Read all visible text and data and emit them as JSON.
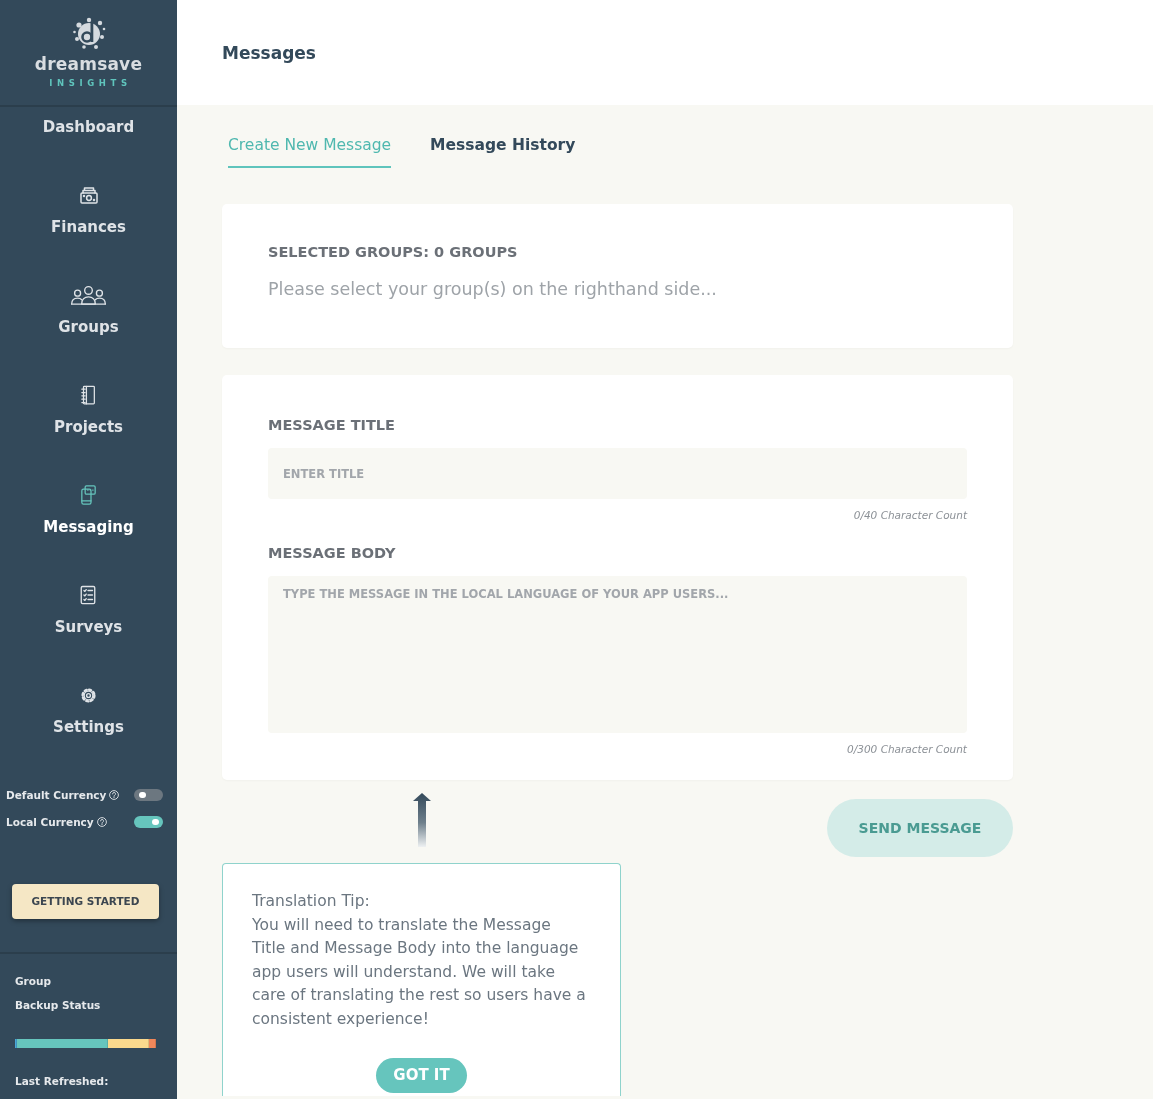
{
  "sidebar": {
    "logo": {
      "name": "dreamsave",
      "tagline": "INSIGHTS"
    },
    "items": [
      {
        "label": "Dashboard",
        "kind": "text",
        "selected": false
      },
      {
        "label": "Finances",
        "kind": "icon",
        "selected": false
      },
      {
        "label": "Groups",
        "kind": "icon",
        "selected": false
      },
      {
        "label": "Projects",
        "kind": "icon",
        "selected": false
      },
      {
        "label": "Messaging",
        "kind": "icon",
        "selected": true
      },
      {
        "label": "Surveys",
        "kind": "icon",
        "selected": false
      },
      {
        "label": "Settings",
        "kind": "icon",
        "selected": false
      }
    ],
    "currency_toggles": [
      {
        "label": "Default Currency",
        "on": false
      },
      {
        "label": "Local Currency",
        "on": true
      }
    ],
    "getting_started": {
      "label": "GETTING STARTED"
    },
    "backup": {
      "title": "Group",
      "subtitle": "Backup Status",
      "last_refreshed": "Last Refreshed:"
    }
  },
  "header": {
    "title": "Messages"
  },
  "tabs": [
    {
      "label": "Create New Message",
      "selected": true
    },
    {
      "label": "Message History",
      "selected": false
    }
  ],
  "selected_groups": {
    "heading": "SELECTED GROUPS: **0 GROUPS**",
    "hint": "Please select your group(s) on the righthand side..."
  },
  "form": {
    "fields": [
      {
        "kind": "input",
        "label": "MESSAGE TITLE",
        "placeholder": "ENTER TITLE",
        "counter": "0/40 Character Count"
      },
      {
        "kind": "textarea",
        "label": "MESSAGE BODY",
        "placeholder": "TYPE THE MESSAGE IN THE LOCAL LANGUAGE OF YOUR APP USERS...",
        "counter": "0/300 Character Count"
      }
    ]
  },
  "send_button": {
    "label": "SEND MESSAGE",
    "disabled": true
  },
  "tip": {
    "title": "Translation Tip:",
    "body": "You will need to translate the Message Title and Message Body into the language app users will understand. We will take care of translating the rest so users have a consistent experience!",
    "button": "GOT IT"
  }
}
